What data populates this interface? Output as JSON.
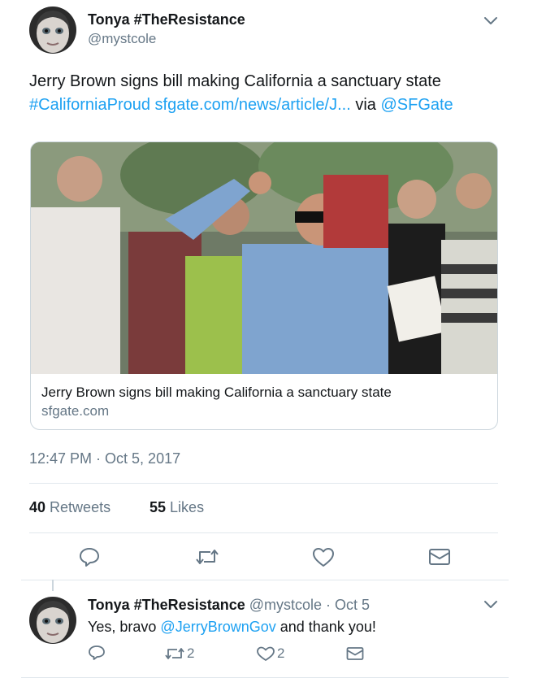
{
  "tweet": {
    "display_name": "Tonya #TheResistance",
    "handle": "@mystcole",
    "text_line1": "Jerry Brown signs bill making California a sanctuary state",
    "hashtag": "#CaliforniaProud",
    "url": "sfgate.com/news/article/J...",
    "via": "via",
    "mention": "@SFGate",
    "card": {
      "title": "Jerry Brown signs bill making California a sanctuary state",
      "domain": "sfgate.com"
    },
    "timestamp": "12:47 PM · Oct 5, 2017",
    "retweets_count": "40",
    "retweets_label": "Retweets",
    "likes_count": "55",
    "likes_label": "Likes"
  },
  "reply": {
    "display_name": "Tonya #TheResistance",
    "meta": "@mystcole · Oct 5",
    "text_before": "Yes, bravo",
    "mention": "@JerryBrownGov",
    "text_after": "and thank you!",
    "retweet_count": "2",
    "like_count": "2"
  },
  "icons": {
    "reply": "reply-icon",
    "retweet": "retweet-icon",
    "like": "heart-icon",
    "message": "envelope-icon",
    "menu": "chevron-down-icon"
  },
  "colors": {
    "link": "#1da1f2",
    "secondary": "#657786",
    "divider": "#e1e8ed"
  }
}
